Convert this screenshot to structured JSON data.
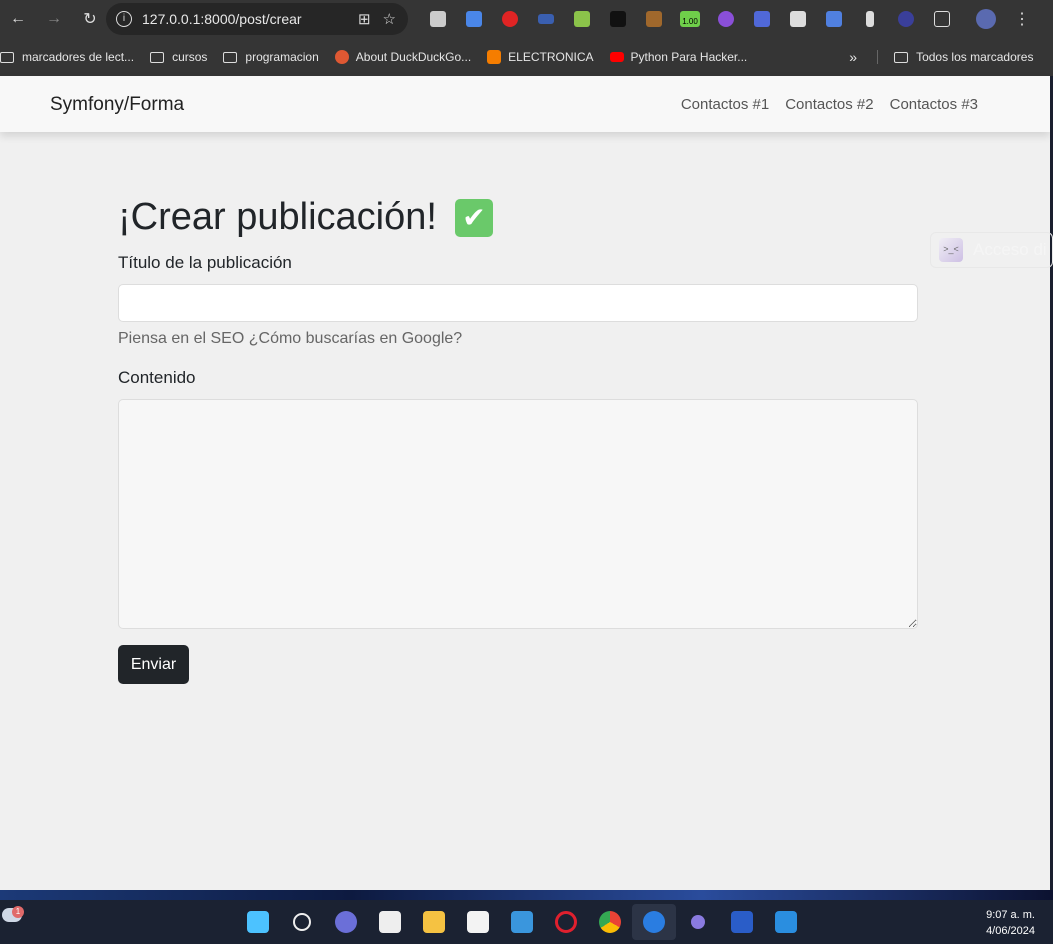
{
  "browser": {
    "url": "127.0.0.1:8000/post/crear",
    "extensions": [
      "translate-ext",
      "google-translate-ext",
      "adblock-ext",
      "zip-ext",
      "download-ext",
      "hat-ext",
      "camel-ext",
      "counter-ext",
      "vpn-ext",
      "jh-ext",
      "mail-ext",
      "screenshot-ext",
      "audio-ext",
      "st-ext",
      "extensions-menu"
    ],
    "extension_badge": "1.00",
    "bookmarks": [
      {
        "label": "marcadores de lect...",
        "type": "folder"
      },
      {
        "label": "cursos",
        "type": "folder"
      },
      {
        "label": "programacion",
        "type": "folder"
      },
      {
        "label": "About DuckDuckGo...",
        "type": "site",
        "color": "#de5833"
      },
      {
        "label": "ELECTRONICA",
        "type": "site",
        "color": "#f57d00"
      },
      {
        "label": "Python Para Hacker...",
        "type": "site",
        "color": "#ff0000"
      }
    ],
    "all_bookmarks": "Todos los marcadores"
  },
  "navbar": {
    "brand": "Symfony/Forma",
    "links": [
      "Contactos #1",
      "Contactos #2",
      "Contactos #3"
    ]
  },
  "form": {
    "title": "¡Crear publicación!",
    "title_emoji": "✔",
    "title_label": "Título de la publicación",
    "title_value": "",
    "title_help": "Piensa en el SEO ¿Cómo buscarías en Google?",
    "content_label": "Contenido",
    "content_value": "",
    "submit": "Enviar"
  },
  "widget": {
    "icon": ">_<",
    "text": "Acceso di"
  },
  "taskbar": {
    "notification_count": "1",
    "apps": [
      "start",
      "search",
      "teams",
      "snipping",
      "explorer",
      "store",
      "mail",
      "opera",
      "chrome",
      "firefox",
      "app",
      "terminal",
      "vscode"
    ],
    "time": "9:07 a. m.",
    "date": "4/06/2024"
  }
}
